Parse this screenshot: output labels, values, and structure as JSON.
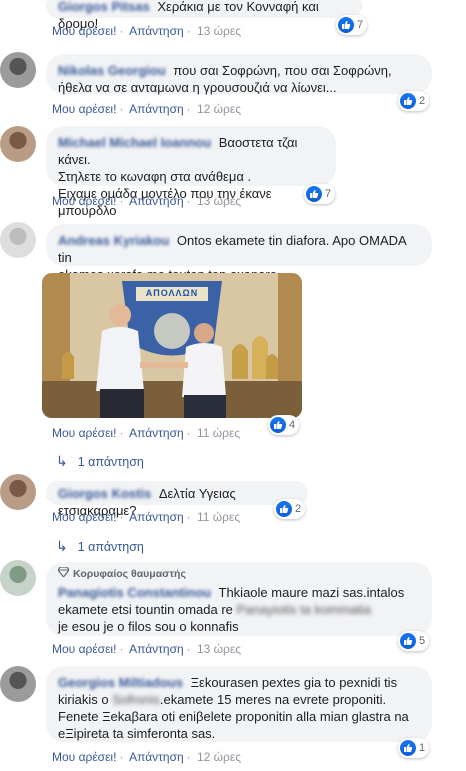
{
  "comments": [
    {
      "author": "Giorgos Pitsas",
      "text_lines": [
        "Χεράκια με τον Κονναφή και δρομο!"
      ],
      "like_label": "Μου αρέσει!",
      "reply_label": "Απάντηση",
      "time": "13 ώρες",
      "reactions": "7"
    },
    {
      "author": "Nikolas Georgiou",
      "text_lines": [
        "που σαι Σοφρώνη, που σαι Σοφρώνη,",
        "ήθελα να σε ανταμωνα η γρουσουζιά να λίωνει..."
      ],
      "like_label": "Μου αρέσει!",
      "reply_label": "Απάντηση",
      "time": "12 ώρες",
      "reactions": "2"
    },
    {
      "author": "Michael Michael Ioannou",
      "text_lines": [
        "Βαοστετα τζαι κάνει.",
        "Στηλετε το κωναφη στα ανάθεμα .",
        "Ειχαμε ομάδα μοντέλο που την έκανε μπουρδλο"
      ],
      "like_label": "Μου αρέσει!",
      "reply_label": "Απάντηση",
      "time": "13 ώρες",
      "reactions": "7"
    },
    {
      "author": "Andreas Kyriakou",
      "text_lines": [
        "Ontos ekamete tin diafora. Apo OMADA tin",
        "ekames xorafa me touton ton axaparo."
      ],
      "photo_sign": "ΑΠΟΛΛΩΝ",
      "like_label": "Μου αρέσει!",
      "reply_label": "Απάντηση",
      "time": "11 ώρες",
      "reactions": "4",
      "replies_label": "1 απάντηση"
    },
    {
      "author": "Giorgos Kostis",
      "text_lines": [
        "Δελτία Υγειας ετσιακαραμε?"
      ],
      "like_label": "Μου αρέσει!",
      "reply_label": "Απάντηση",
      "time": "11 ώρες",
      "reactions": "2",
      "replies_label": "1 απάντηση"
    },
    {
      "badge": "Κορυφαίος θαυμαστής",
      "author": "Panagiotis Constantinou",
      "text_lines": [
        "Thkiaole maure mazi sas.intalos",
        "ekamete etsi tountin omada re",
        "je esou je o filos sou o konnafis"
      ],
      "blurred_words": [
        "Panayiotis",
        "ta kommatia"
      ],
      "like_label": "Μου αρέσει!",
      "reply_label": "Απάντηση",
      "time": "13 ώρες",
      "reactions": "5"
    },
    {
      "author": "Georgios Miltiadous",
      "text_lines": [
        "Ξεkourasen pextes gia to pexnidi tis",
        "kiriakis o",
        ".ekamete 15 meres na evrete proponiti.",
        "Fenete Ξekaβara oti eniβelete proponitin alla mian glastra na",
        "eΞipireta ta simferonta sas."
      ],
      "blurred_words": [
        "Sofronis"
      ],
      "like_label": "Μου αρέσει!",
      "reply_label": "Απάντηση",
      "time": "12 ώρες",
      "reactions": "1"
    }
  ],
  "colors": {
    "link": "#385898",
    "bubble": "#f2f3f5",
    "meta": "#90949c",
    "like_blue": "#1877f2"
  }
}
